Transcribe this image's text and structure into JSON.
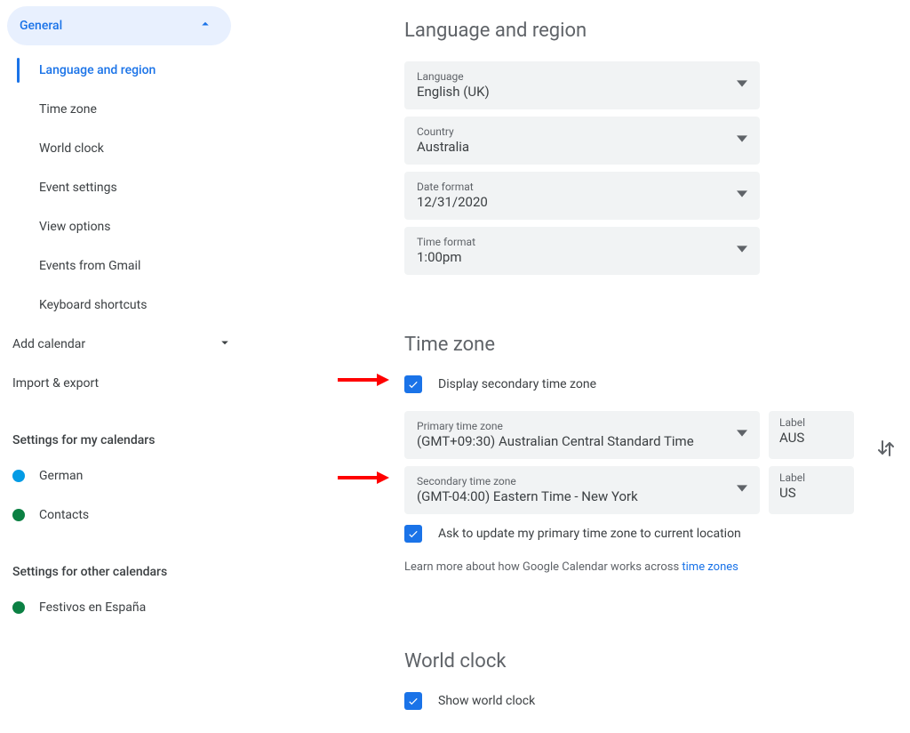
{
  "sidebar": {
    "general_label": "General",
    "items": [
      "Language and region",
      "Time zone",
      "World clock",
      "Event settings",
      "View options",
      "Events from Gmail",
      "Keyboard shortcuts"
    ],
    "add_calendar": "Add calendar",
    "import_export": "Import & export",
    "my_cal_heading": "Settings for my calendars",
    "my_calendars": [
      {
        "name": "German",
        "color": "#039be5"
      },
      {
        "name": "Contacts",
        "color": "#0b8043"
      }
    ],
    "other_cal_heading": "Settings for other calendars",
    "other_calendars": [
      {
        "name": "Festivos en España",
        "color": "#0b8043"
      }
    ]
  },
  "lang_region": {
    "heading": "Language and region",
    "language": {
      "label": "Language",
      "value": "English (UK)"
    },
    "country": {
      "label": "Country",
      "value": "Australia"
    },
    "date_format": {
      "label": "Date format",
      "value": "12/31/2020"
    },
    "time_format": {
      "label": "Time format",
      "value": "1:00pm"
    }
  },
  "timezone": {
    "heading": "Time zone",
    "display_secondary": "Display secondary time zone",
    "primary": {
      "label": "Primary time zone",
      "value": "(GMT+09:30) Australian Central Standard Time"
    },
    "primary_label_box": {
      "caption": "Label",
      "value": "AUS"
    },
    "secondary": {
      "label": "Secondary time zone",
      "value": "(GMT-04:00) Eastern Time - New York"
    },
    "secondary_label_box": {
      "caption": "Label",
      "value": "US"
    },
    "ask_update": "Ask to update my primary time zone to current location",
    "hint_prefix": "Learn more about how Google Calendar works across ",
    "hint_link": "time zones"
  },
  "world_clock": {
    "heading": "World clock",
    "show": "Show world clock"
  }
}
